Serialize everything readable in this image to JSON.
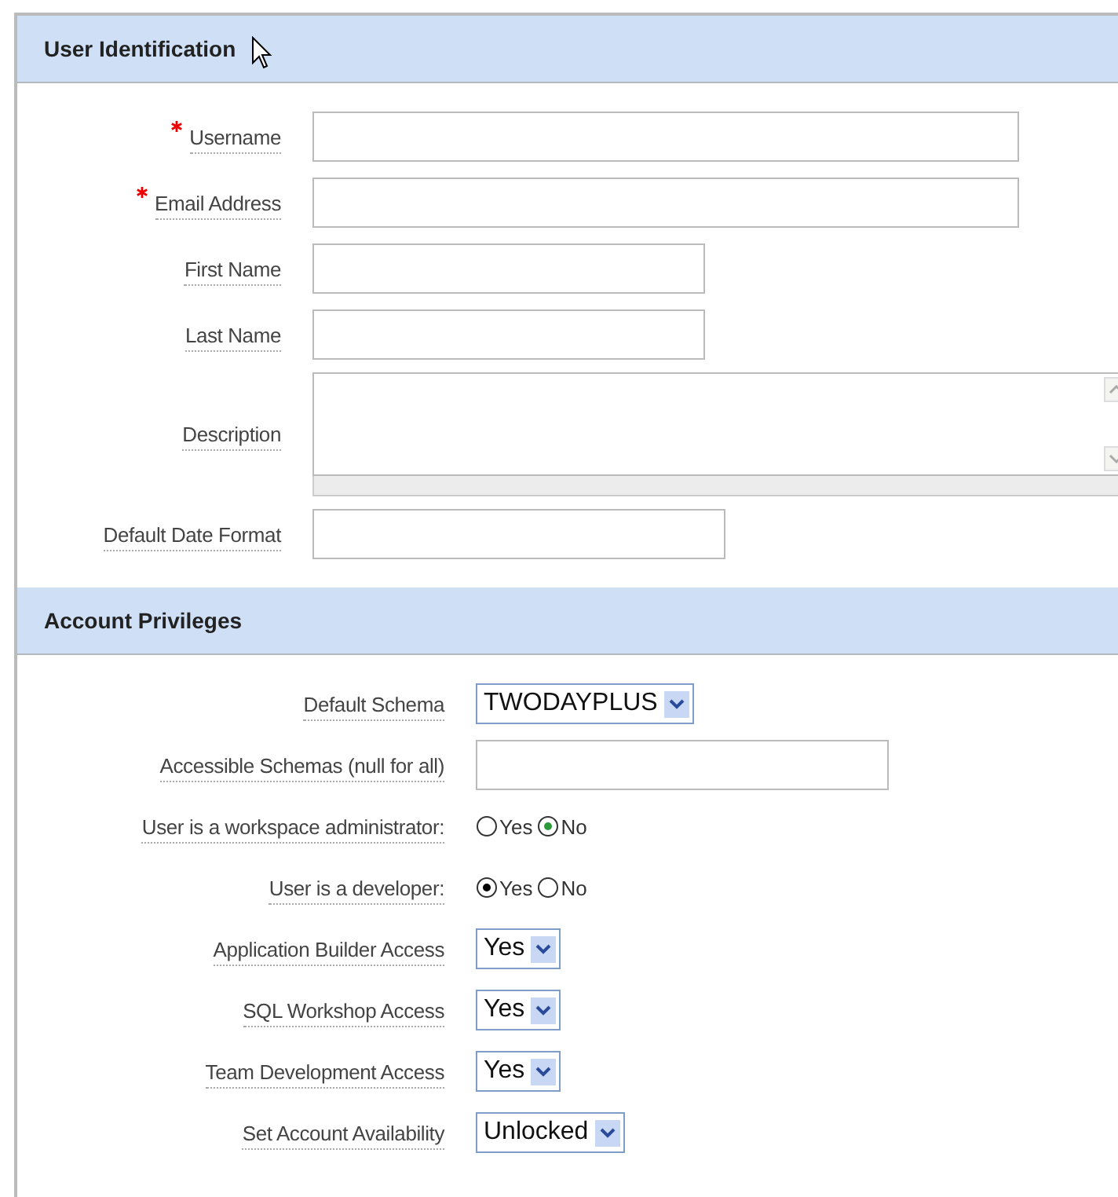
{
  "sections": [
    {
      "title": "User Identification",
      "fields": [
        {
          "kind": "text",
          "label": "Username",
          "required": true
        },
        {
          "kind": "text",
          "label": "Email Address",
          "required": true
        },
        {
          "kind": "text",
          "label": "First Name",
          "required": false
        },
        {
          "kind": "text",
          "label": "Last Name",
          "required": false
        },
        {
          "kind": "textarea",
          "label": "Description",
          "required": false
        },
        {
          "kind": "text",
          "label": "Default Date Format",
          "required": false
        }
      ]
    },
    {
      "title": "Account Privileges",
      "fields": [
        {
          "kind": "select",
          "label": "Default Schema",
          "value": "TWODAYPLUS"
        },
        {
          "kind": "text",
          "label": "Accessible Schemas (null for all)"
        },
        {
          "kind": "radio",
          "label": "User is a workspace administrator:",
          "options": [
            {
              "label": "Yes",
              "selected": false
            },
            {
              "label": "No",
              "selected": true
            }
          ]
        },
        {
          "kind": "radio",
          "label": "User is a developer:",
          "options": [
            {
              "label": "Yes",
              "selected": true
            },
            {
              "label": "No",
              "selected": false
            }
          ]
        },
        {
          "kind": "select",
          "label": "Application Builder Access",
          "value": "Yes"
        },
        {
          "kind": "select",
          "label": "SQL Workshop Access",
          "value": "Yes"
        },
        {
          "kind": "select",
          "label": "Team Development Access",
          "value": "Yes"
        },
        {
          "kind": "select",
          "label": "Set Account Availability",
          "value": "Unlocked"
        }
      ]
    }
  ]
}
